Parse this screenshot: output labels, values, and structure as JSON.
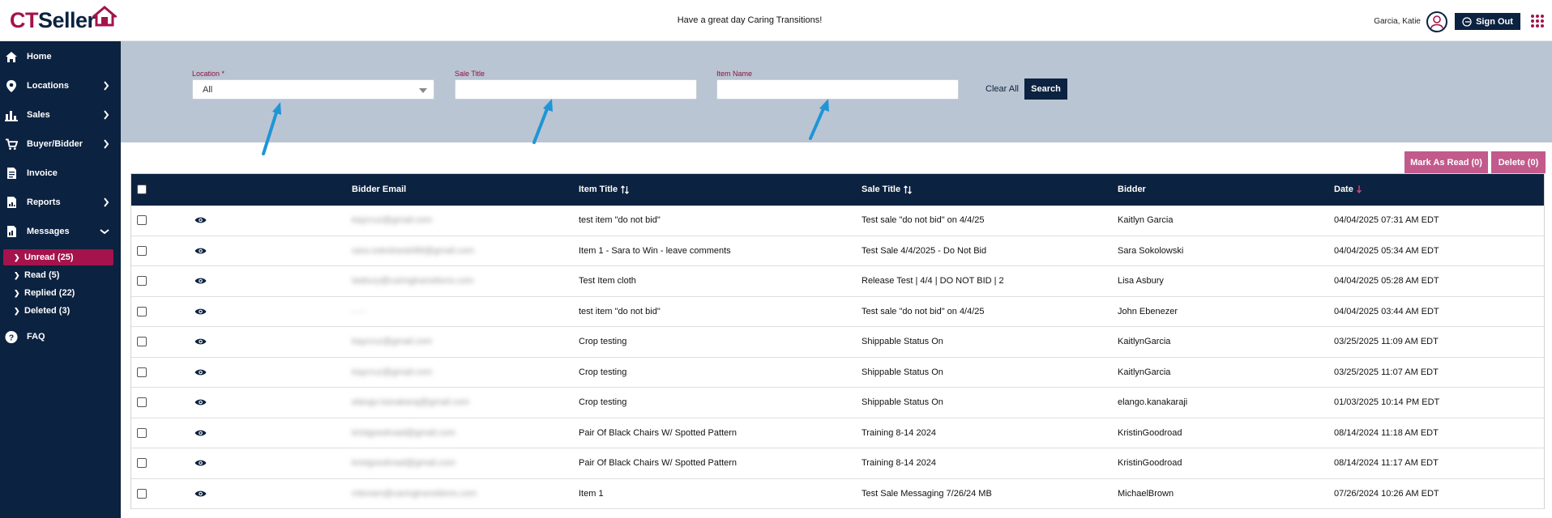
{
  "app": {
    "greeting": "Have a great day Caring Transitions!",
    "user_name": "Garcia, Katie",
    "signout_label": "Sign Out",
    "logo_ct": "CT",
    "logo_seller": "Seller"
  },
  "colors": {
    "navy": "#0b2240",
    "brand": "#a4134b",
    "filter_bg": "#bac5d3",
    "action_pink": "#c25a8b"
  },
  "sidebar": {
    "items": [
      {
        "label": "Home",
        "icon": "home-icon"
      },
      {
        "label": "Locations",
        "icon": "location-pin-icon"
      },
      {
        "label": "Sales",
        "icon": "sales-chart-icon"
      },
      {
        "label": "Buyer/Bidder",
        "icon": "cart-icon"
      },
      {
        "label": "Invoice",
        "icon": "invoice-icon"
      },
      {
        "label": "Reports",
        "icon": "report-icon"
      },
      {
        "label": "Messages",
        "icon": "messages-icon"
      },
      {
        "label": "FAQ",
        "icon": "question-icon"
      }
    ],
    "messages_sub": [
      {
        "label": "Unread (25)"
      },
      {
        "label": "Read (5)"
      },
      {
        "label": "Replied (22)"
      },
      {
        "label": "Deleted (3)"
      }
    ]
  },
  "filters": {
    "location_label": "Location *",
    "location_value": "All",
    "sale_title_label": "Sale Title",
    "sale_title_value": "",
    "item_name_label": "Item Name",
    "item_name_value": "",
    "clear_all": "Clear All",
    "search": "Search"
  },
  "actions": {
    "mark_read": "Mark As Read (0)",
    "delete": "Delete (0)"
  },
  "table": {
    "headers": {
      "bidder_email": "Bidder Email",
      "item_title": "Item Title",
      "sale_title": "Sale Title",
      "bidder": "Bidder",
      "date": "Date"
    },
    "rows": [
      {
        "email": "kaycruz@gmail.com",
        "item": "test item \"do not bid\"",
        "sale": "Test sale \"do not bid\" on 4/4/25",
        "bidder": "Kaitlyn Garcia",
        "date": "04/04/2025 07:31 AM EDT"
      },
      {
        "email": "sara.sokolowski88@gmail.com",
        "item": "Item 1 - Sara to Win - leave comments",
        "sale": "Test Sale 4/4/2025 - Do Not Bid",
        "bidder": "Sara Sokolowski",
        "date": "04/04/2025 05:34 AM EDT"
      },
      {
        "email": "lasbury@caringtransitions.com",
        "item": "Test Item cloth",
        "sale": "Release Test | 4/4 | DO NOT BID | 2",
        "bidder": "Lisa Asbury",
        "date": "04/04/2025 05:28 AM EDT"
      },
      {
        "email": "- - -",
        "item": "test item \"do not bid\"",
        "sale": "Test sale \"do not bid\" on 4/4/25",
        "bidder": "John Ebenezer",
        "date": "04/04/2025 03:44 AM EDT"
      },
      {
        "email": "kaycruz@gmail.com",
        "item": "Crop testing",
        "sale": "Shippable Status On",
        "bidder": "KaitlynGarcia",
        "date": "03/25/2025 11:09 AM EDT"
      },
      {
        "email": "kaycruz@gmail.com",
        "item": "Crop testing",
        "sale": "Shippable Status On",
        "bidder": "KaitlynGarcia",
        "date": "03/25/2025 11:07 AM EDT"
      },
      {
        "email": "elango.kanakaraj@gmail.com",
        "item": "Crop testing",
        "sale": "Shippable Status On",
        "bidder": "elango.kanakaraji",
        "date": "01/03/2025 10:14 PM EDT"
      },
      {
        "email": "kristgoodroad@gmail.com",
        "item": "Pair Of Black Chairs W/ Spotted Pattern",
        "sale": "Training 8-14 2024",
        "bidder": "KristinGoodroad",
        "date": "08/14/2024 11:18 AM EDT"
      },
      {
        "email": "kristgoodroad@gmail.com",
        "item": "Pair Of Black Chairs W/ Spotted Pattern",
        "sale": "Training 8-14 2024",
        "bidder": "KristinGoodroad",
        "date": "08/14/2024 11:17 AM EDT"
      },
      {
        "email": "mbrown@caringtransitions.com",
        "item": "Item 1",
        "sale": "Test Sale Messaging 7/26/24 MB",
        "bidder": "MichaelBrown",
        "date": "07/26/2024 10:26 AM EDT"
      }
    ]
  }
}
